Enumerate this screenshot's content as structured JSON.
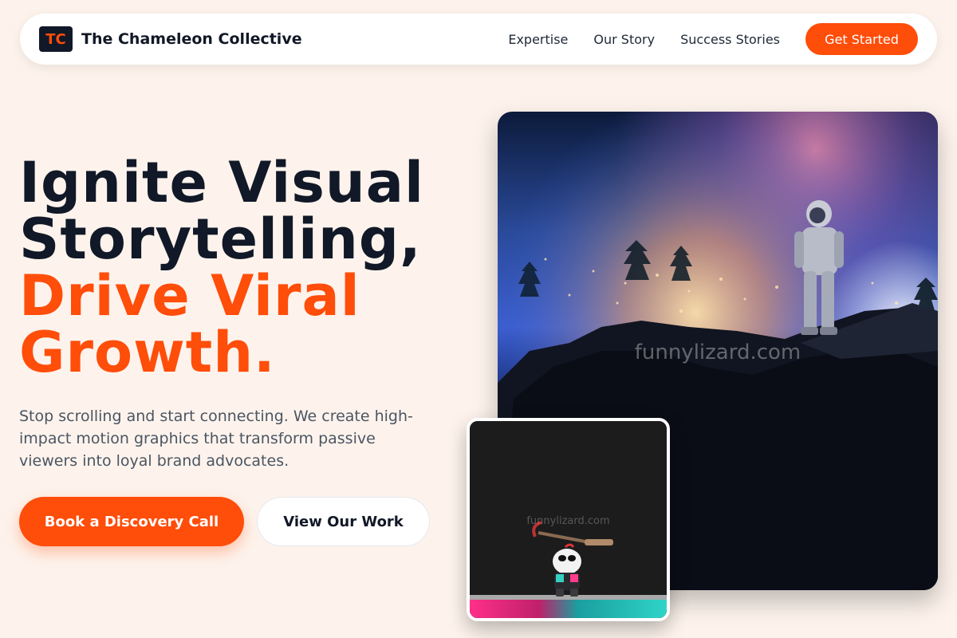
{
  "nav": {
    "logo_mark": "TC",
    "brand_name": "The Chameleon Collective",
    "links": [
      "Expertise",
      "Our Story",
      "Success Stories"
    ],
    "cta_label": "Get Started"
  },
  "hero": {
    "title_line1": "Ignite Visual",
    "title_line2": "Storytelling,",
    "title_accent_line1": "Drive Viral",
    "title_accent_line2": "Growth.",
    "description": "Stop scrolling and start connecting. We create high-impact motion graphics that transform passive viewers into loyal brand advocates.",
    "primary_button": "Book a Discovery Call",
    "secondary_button": "View Our Work"
  },
  "images": {
    "main_watermark": "funnylizard.com",
    "small_watermark": "funnylizard.com"
  },
  "colors": {
    "accent": "#ff4d0a",
    "dark": "#111827",
    "background": "#fdf3ec"
  }
}
